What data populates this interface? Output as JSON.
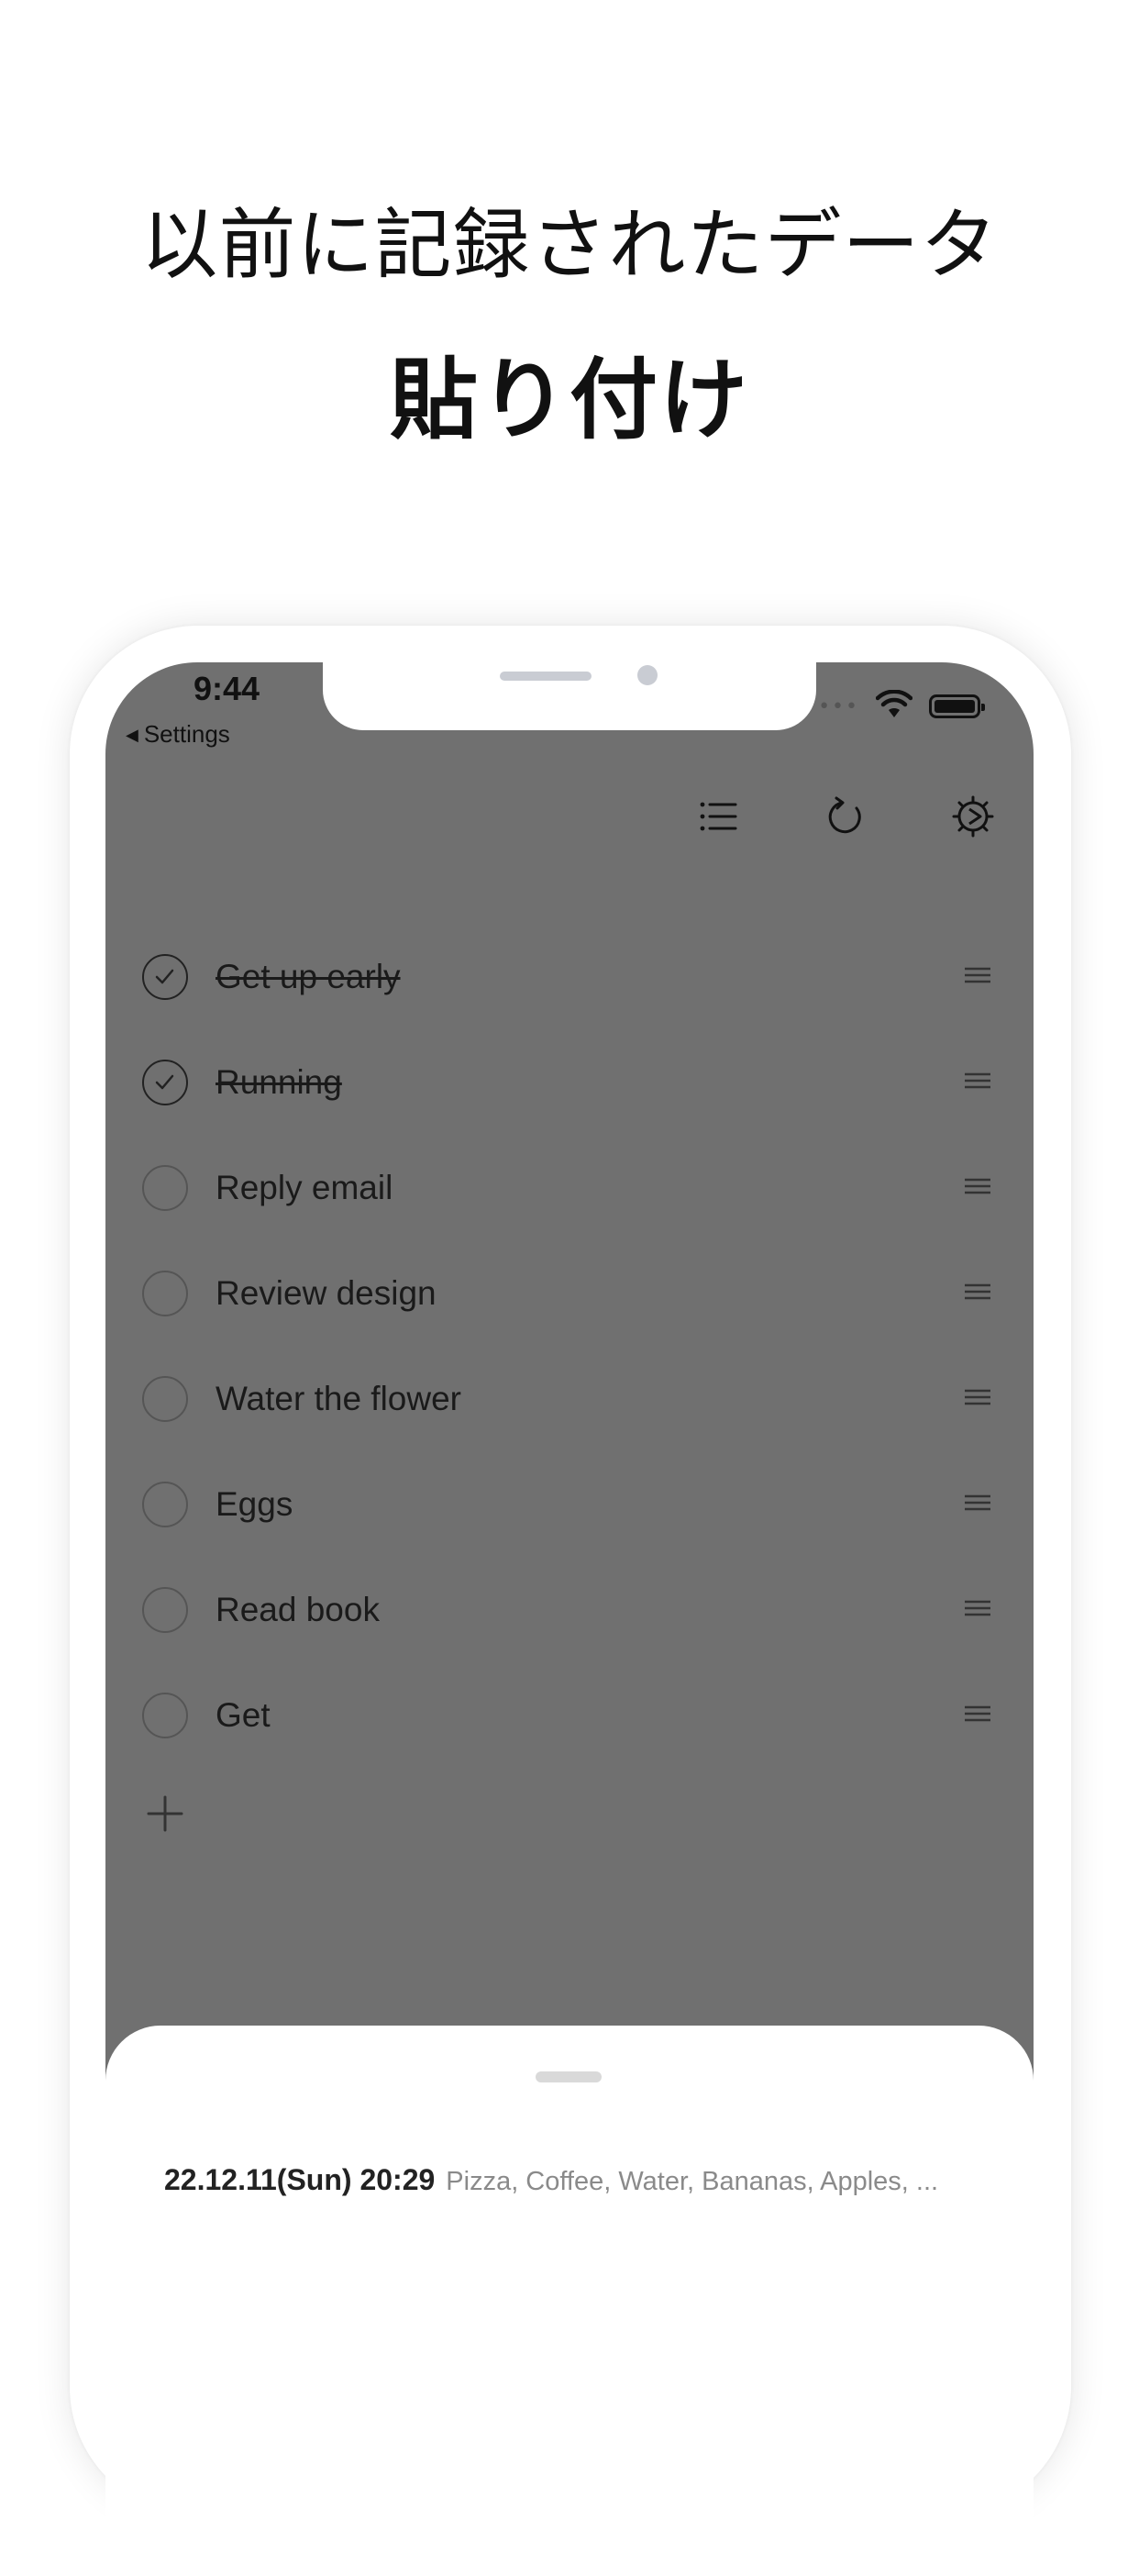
{
  "headline": {
    "line1": "以前に記録されたデータ",
    "line2": "貼り付け"
  },
  "status_bar": {
    "time": "9:44",
    "back_label": "Settings",
    "signal_dots": "•••"
  },
  "toolbar": {
    "icons": [
      "list-icon",
      "refresh-icon",
      "settings-gear-icon"
    ]
  },
  "todos": [
    {
      "label": "Get up early",
      "done": true
    },
    {
      "label": "Running",
      "done": true
    },
    {
      "label": "Reply email",
      "done": false
    },
    {
      "label": "Review design",
      "done": false
    },
    {
      "label": "Water the flower",
      "done": false
    },
    {
      "label": "Eggs",
      "done": false
    },
    {
      "label": "Read book",
      "done": false
    },
    {
      "label": "Get",
      "done": false
    }
  ],
  "history": {
    "date": "22.12.11(Sun) 20:29",
    "items": "Pizza, Coffee, Water, Bananas, Apples, ..."
  },
  "colors": {
    "overlay": "#707070",
    "text": "#1a1a1a",
    "muted": "#8a8a8a"
  }
}
